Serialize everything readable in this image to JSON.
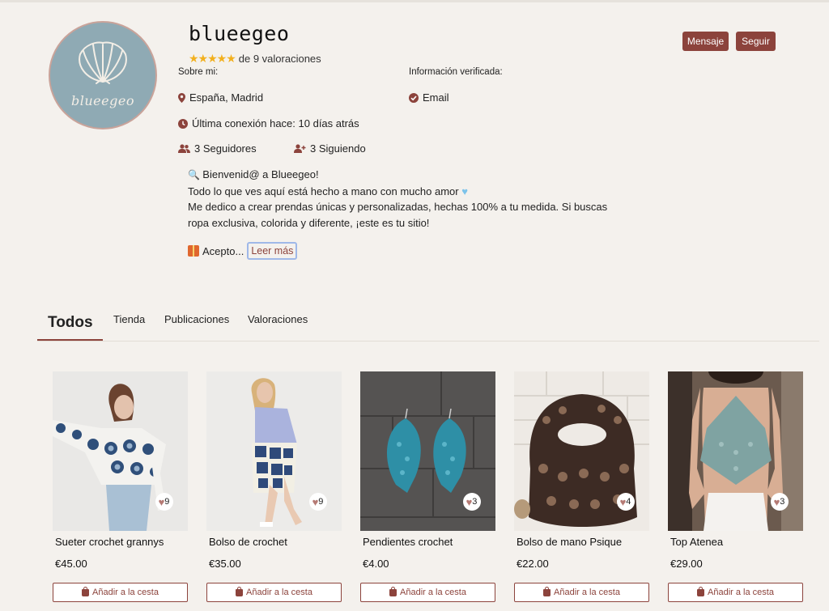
{
  "profile": {
    "logo_text": "blueegeo",
    "username": "blueegeo",
    "stars": "★★★★★",
    "rating_text": "de 9 valoraciones",
    "about_label": "Sobre mi:",
    "verified_label": "Información verificada:",
    "location": "España, Madrid",
    "verified_email": "Email",
    "last_connection": "Última conexión hace: 10 días atrás",
    "followers": "3 Seguidores",
    "following": "3 Siguiendo",
    "bio_lines": [
      "Bienvenid@ a Blueegeo!",
      "Todo lo que ves aquí está hecho a mano con mucho amor",
      "Me dedico a crear prendas únicas y personalizadas, hechas 100% a tu medida. Si buscas",
      "ropa exclusiva, colorida y diferente, ¡este es tu sitio!"
    ],
    "accept_text": "Acepto...",
    "read_more": "Leer más"
  },
  "actions": {
    "message": "Mensaje",
    "follow": "Seguir"
  },
  "tabs": [
    {
      "label": "Todos",
      "active": true
    },
    {
      "label": "Tienda",
      "active": false
    },
    {
      "label": "Publicaciones",
      "active": false
    },
    {
      "label": "Valoraciones",
      "active": false
    }
  ],
  "products": [
    {
      "name": "Sueter crochet grannys",
      "price": "€45.00",
      "likes": "9",
      "cart": "Añadir a la cesta"
    },
    {
      "name": "Bolso de crochet",
      "price": "€35.00",
      "likes": "9",
      "cart": "Añadir a la cesta"
    },
    {
      "name": "Pendientes crochet",
      "price": "€4.00",
      "likes": "3",
      "cart": "Añadir a la cesta"
    },
    {
      "name": "Bolso de mano Psique",
      "price": "€22.00",
      "likes": "4",
      "cart": "Añadir a la cesta"
    },
    {
      "name": "Top Atenea",
      "price": "€29.00",
      "likes": "3",
      "cart": "Añadir a la cesta"
    }
  ],
  "colors": {
    "accent": "#8c433c",
    "background": "#f4f1ed",
    "star": "#f2b01e",
    "avatar_bg": "#8faab4"
  }
}
